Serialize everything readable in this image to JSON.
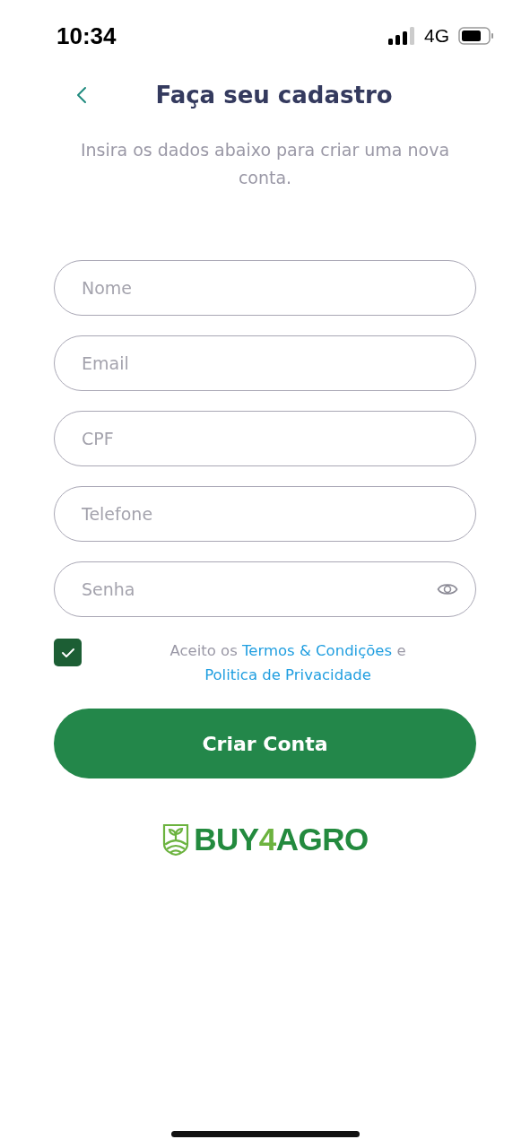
{
  "status_bar": {
    "time": "10:34",
    "network": "4G"
  },
  "header": {
    "title": "Faça seu cadastro"
  },
  "subtitle": "Insira os dados abaixo para criar uma nova conta.",
  "fields": [
    {
      "kind": "text",
      "placeholder": "Nome"
    },
    {
      "kind": "text",
      "placeholder": "Email"
    },
    {
      "kind": "text",
      "placeholder": "CPF"
    },
    {
      "kind": "text",
      "placeholder": "Telefone"
    },
    {
      "kind": "password",
      "placeholder": "Senha"
    }
  ],
  "terms": {
    "checked": true,
    "parts": [
      {
        "kind": "text",
        "text": "Aceito os"
      },
      {
        "kind": "link",
        "text": "Termos & Condições"
      },
      {
        "kind": "text",
        "text": "e"
      },
      {
        "kind": "link",
        "text": "Politica de Privacidade"
      }
    ]
  },
  "submit_button": "Criar Conta",
  "logo": {
    "parts": [
      {
        "text": "BUY",
        "color": "#238a3e"
      },
      {
        "text": "4",
        "color": "#6cb33f"
      },
      {
        "text": "AGRO",
        "color": "#238a3e"
      }
    ]
  }
}
